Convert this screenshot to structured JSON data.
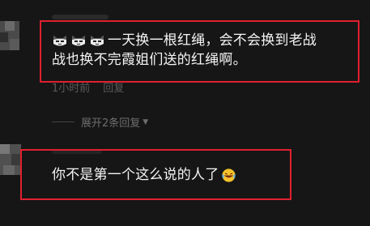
{
  "comment1": {
    "emojis": [
      "cat-face-icon",
      "cat-face-icon",
      "cat-face-icon"
    ],
    "line1": "一天换一根红绳，会不会换到老战",
    "line2": "战也换不完霞姐们送的红绳啊。",
    "time": "1小时前",
    "reply_label": "回复"
  },
  "expand_replies": {
    "label": "展开2条回复"
  },
  "comment2": {
    "text": "你不是第一个这么说的人了",
    "emoji": "laughing-tears-icon"
  },
  "colors": {
    "background": "#161616",
    "highlight": "#e0202e",
    "text": "#f4f4f4",
    "meta": "#5a5a5a"
  }
}
